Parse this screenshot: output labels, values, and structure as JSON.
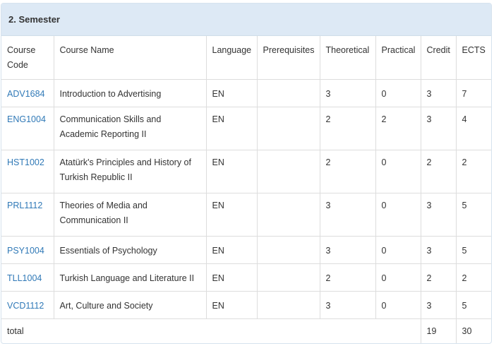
{
  "panel": {
    "title": "2. Semester"
  },
  "columns": {
    "code": "Course Code",
    "name": "Course Name",
    "language": "Language",
    "prerequisites": "Prerequisites",
    "theoretical": "Theoretical",
    "practical": "Practical",
    "credit": "Credit",
    "ects": "ECTS"
  },
  "courses": [
    {
      "code": "ADV1684",
      "name": "Introduction to Advertising",
      "language": "EN",
      "prerequisites": "",
      "theoretical": "3",
      "practical": "0",
      "credit": "3",
      "ects": "7"
    },
    {
      "code": "ENG1004",
      "name": "Communication Skills and Academic Reporting II",
      "language": "EN",
      "prerequisites": "",
      "theoretical": "2",
      "practical": "2",
      "credit": "3",
      "ects": "4"
    },
    {
      "code": "HST1002",
      "name": "Atatürk's Principles and History of Turkish Republic II",
      "language": "EN",
      "prerequisites": "",
      "theoretical": "2",
      "practical": "0",
      "credit": "2",
      "ects": "2"
    },
    {
      "code": "PRL1112",
      "name": "Theories of Media and Communication II",
      "language": "EN",
      "prerequisites": "",
      "theoretical": "3",
      "practical": "0",
      "credit": "3",
      "ects": "5"
    },
    {
      "code": "PSY1004",
      "name": "Essentials of Psychology",
      "language": "EN",
      "prerequisites": "",
      "theoretical": "3",
      "practical": "0",
      "credit": "3",
      "ects": "5"
    },
    {
      "code": "TLL1004",
      "name": "Turkish Language and Literature II",
      "language": "EN",
      "prerequisites": "",
      "theoretical": "2",
      "practical": "0",
      "credit": "2",
      "ects": "2"
    },
    {
      "code": "VCD1112",
      "name": "Art, Culture and Society",
      "language": "EN",
      "prerequisites": "",
      "theoretical": "3",
      "practical": "0",
      "credit": "3",
      "ects": "5"
    }
  ],
  "total": {
    "label": "total",
    "credit": "19",
    "ects": "30"
  },
  "colors": {
    "link": "#3079b7",
    "heading_bg": "#dde9f5",
    "border": "#dddddd"
  }
}
